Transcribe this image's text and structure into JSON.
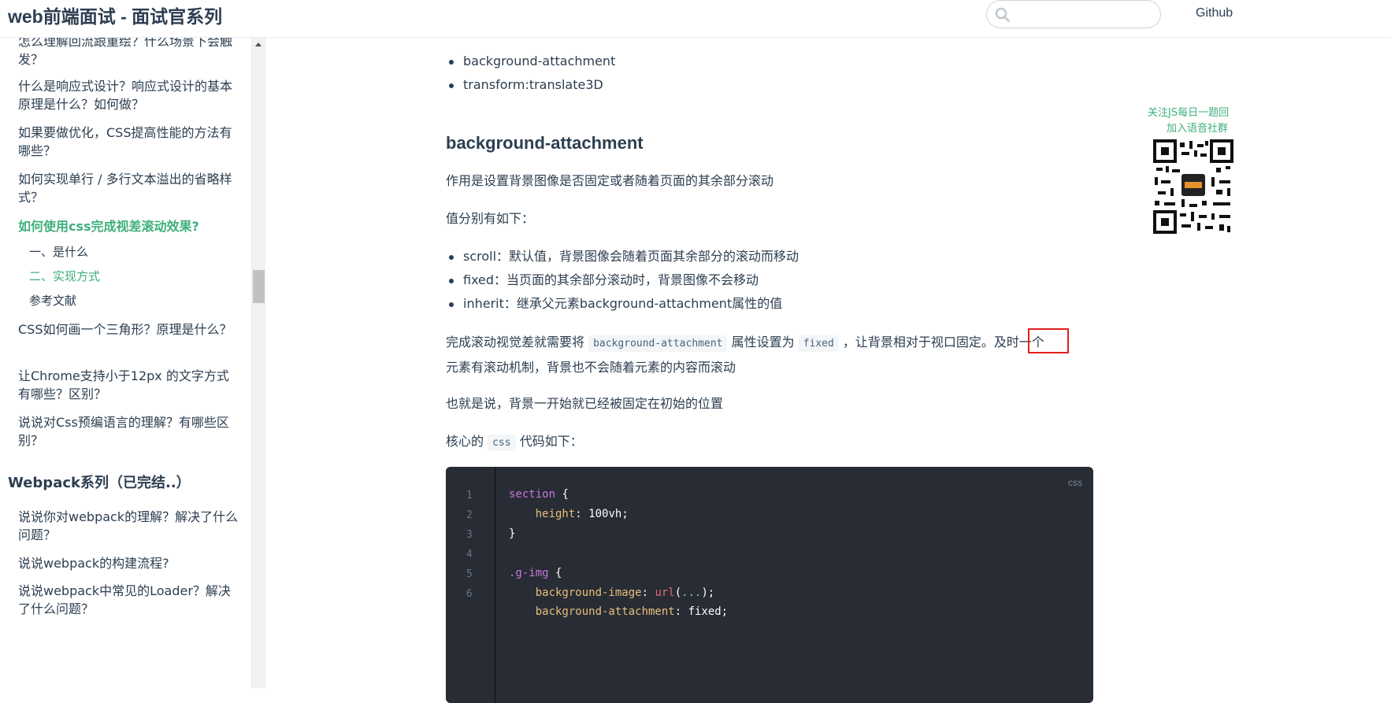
{
  "navbar": {
    "title": "web前端面试 - 面试官系列",
    "search_placeholder": "",
    "github_label": "Github"
  },
  "sidebar": {
    "items": [
      {
        "label": "怎么理解回流跟重绘？什么场景下会触发？",
        "active": false
      },
      {
        "label": "什么是响应式设计？响应式设计的基本原理是什么？如何做？",
        "active": false
      },
      {
        "label": "如果要做优化，CSS提高性能的方法有哪些？",
        "active": false
      },
      {
        "label": "如何实现单行 / 多行文本溢出的省略样式？",
        "active": false
      },
      {
        "label": "如何使用css完成视差滚动效果?",
        "active": true
      },
      {
        "label": "CSS如何画一个三角形？原理是什么？",
        "active": false
      },
      {
        "label": "让Chrome支持小于12px 的文字方式有哪些？区别？",
        "active": false
      },
      {
        "label": "说说对Css预编语言的理解？有哪些区别？",
        "active": false
      }
    ],
    "subitems": [
      {
        "label": "一、是什么",
        "active": false
      },
      {
        "label": "二、实现方式",
        "active": true
      },
      {
        "label": "参考文献",
        "active": false
      }
    ],
    "group_title": "Webpack系列（已完结..）",
    "group_items": [
      "说说你对webpack的理解？解决了什么问题？",
      "说说webpack的构建流程?",
      "说说webpack中常见的Loader？解决了什么问题？"
    ]
  },
  "content": {
    "top_list": [
      "background-attachment",
      "transform:translate3D"
    ],
    "heading": "background-attachment",
    "p1": "作用是设置背景图像是否固定或者随着页面的其余部分滚动",
    "p2": "值分别有如下：",
    "values_list": [
      "scroll：默认值，背景图像会随着页面其余部分的滚动而移动",
      "fixed：当页面的其余部分滚动时，背景图像不会移动",
      "inherit：继承父元素background-attachment属性的值"
    ],
    "p3_part1": "完成滚动视觉差就需要将",
    "p3_code1": "background-attachment",
    "p3_part2": "属性设置为",
    "p3_code2": "fixed",
    "p3_part3": "，让背景相对于视口固定。及时一个",
    "p3_line2": "元素有滚动机制，背景也不会随着元素的内容而滚动",
    "p4": "也就是说，背景一开始就已经被固定在初始的位置",
    "p5_part1": "核心的",
    "p5_code": "css",
    "p5_part2": "代码如下："
  },
  "codeblock": {
    "language": "css",
    "line_numbers": [
      "1",
      "2",
      "3",
      "4",
      "5",
      "6"
    ],
    "lines": [
      {
        "sel": "section",
        "rest": " {"
      },
      {
        "prop": "height",
        "val": "100vh"
      },
      {
        "plain": "}"
      },
      {
        "plain": ""
      },
      {
        "sel": ".g-img",
        "rest": " {"
      },
      {
        "prop": "background-image",
        "fn": "url",
        "arg": "..."
      },
      {
        "prop": "background-attachment",
        "val": "fixed"
      }
    ]
  },
  "ad": {
    "line1": "关注JS每日一题回",
    "line2": "加入语音社群"
  },
  "colors": {
    "accent": "#3eaf7c",
    "text": "#2c3e50",
    "code_bg": "#282c34",
    "highlight": "#e02020"
  }
}
